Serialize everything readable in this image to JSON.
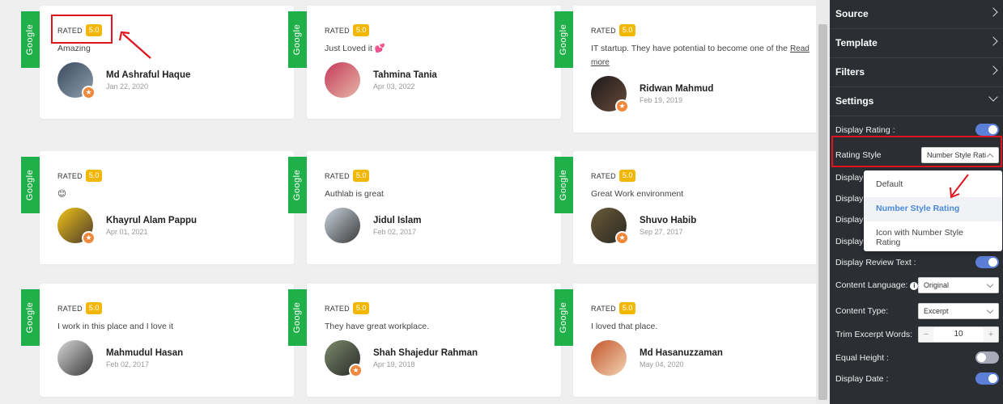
{
  "colors": {
    "google_tab": "#20b04a",
    "rating_badge": "#f2b705",
    "panel_bg": "#2b2e33",
    "toggle_on": "#5b7fd6",
    "highlight": "#e0141e"
  },
  "reviews": [
    {
      "source": "Google",
      "rated_label": "RATED",
      "rating": "5.0",
      "text": "Amazing",
      "more": "",
      "name": "Md Ashraful Haque",
      "date": "Jan 22, 2020"
    },
    {
      "source": "Google",
      "rated_label": "RATED",
      "rating": "5.0",
      "text": "Just Loved it 💕",
      "more": "",
      "name": "Tahmina Tania",
      "date": "Apr 03, 2022"
    },
    {
      "source": "Google",
      "rated_label": "RATED",
      "rating": "5.0",
      "text": "IT startup. They have potential to become one of the",
      "more": "Read more",
      "name": "Ridwan Mahmud",
      "date": "Feb 19, 2019"
    },
    {
      "source": "Google",
      "rated_label": "RATED",
      "rating": "5.0",
      "text": "😊",
      "more": "",
      "name": "Khayrul Alam Pappu",
      "date": "Apr 01, 2021"
    },
    {
      "source": "Google",
      "rated_label": "RATED",
      "rating": "5.0",
      "text": "Authlab is great",
      "more": "",
      "name": "Jidul Islam",
      "date": "Feb 02, 2017"
    },
    {
      "source": "Google",
      "rated_label": "RATED",
      "rating": "5.0",
      "text": "Great Work environment",
      "more": "",
      "name": "Shuvo Habib",
      "date": "Sep 27, 2017"
    },
    {
      "source": "Google",
      "rated_label": "RATED",
      "rating": "5.0",
      "text": "I work in this place and I love it",
      "more": "",
      "name": "Mahmudul Hasan",
      "date": "Feb 02, 2017"
    },
    {
      "source": "Google",
      "rated_label": "RATED",
      "rating": "5.0",
      "text": "They have great workplace.",
      "more": "",
      "name": "Shah Shajedur Rahman",
      "date": "Apr 19, 2018"
    },
    {
      "source": "Google",
      "rated_label": "RATED",
      "rating": "5.0",
      "text": "I loved that place.",
      "more": "",
      "name": "Md Hasanuzzaman",
      "date": "May 04, 2020"
    }
  ],
  "panel": {
    "sections": {
      "source": "Source",
      "template": "Template",
      "filters": "Filters",
      "settings": "Settings"
    },
    "display_rating": "Display Rating :",
    "rating_style": {
      "label": "Rating Style",
      "value": "Number Style Rati"
    },
    "hidden_rows": [
      "Display",
      "Display",
      "Display",
      "Display"
    ],
    "display_review_text": "Display Review Text :",
    "content_language": {
      "label": "Content Language:",
      "value": "Original"
    },
    "content_type": {
      "label": "Content Type:",
      "value": "Excerpt"
    },
    "trim_excerpt": {
      "label": "Trim Excerpt Words:",
      "value": "10",
      "minus": "−",
      "plus": "+"
    },
    "equal_height": "Equal Height :",
    "display_date": "Display Date :",
    "dropdown": [
      "Default",
      "Number Style Rating",
      "Icon with Number Style Rating"
    ]
  }
}
